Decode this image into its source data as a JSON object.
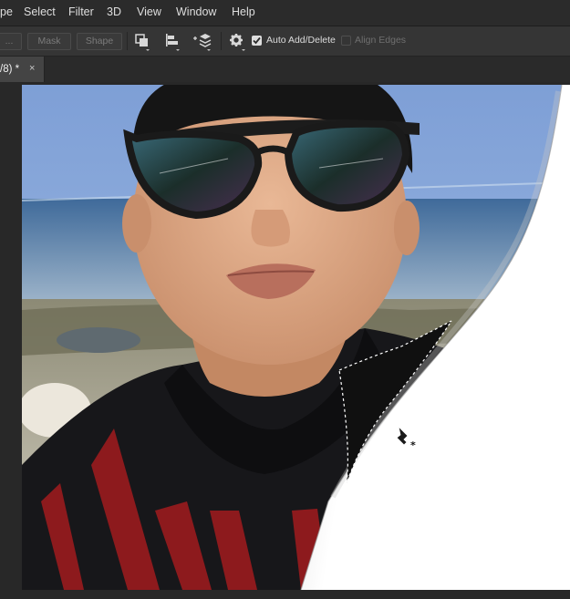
{
  "menu": [
    "pe",
    "Select",
    "Filter",
    "3D",
    "View",
    "Window",
    "Help"
  ],
  "options": {
    "path_button_label": "...",
    "mask_button_label": "Mask",
    "shape_button_label": "Shape",
    "auto_add_delete_label": "Auto Add/Delete",
    "auto_add_delete_checked": true,
    "align_edges_label": "Align Edges",
    "align_edges_checked": false
  },
  "document_tab": {
    "title": "/8) *",
    "close_glyph": "×"
  },
  "colors": {
    "menubar_bg": "#2b2b2b",
    "options_bg": "#353535",
    "canvas_bg": "#282828",
    "active_tab_bg": "#444444",
    "page_curl_white": "#ffffff"
  },
  "icons": [
    "path-operations-icon",
    "path-alignment-icon",
    "path-arrangement-icon",
    "gear-icon",
    "pen-tool-cursor-icon"
  ]
}
